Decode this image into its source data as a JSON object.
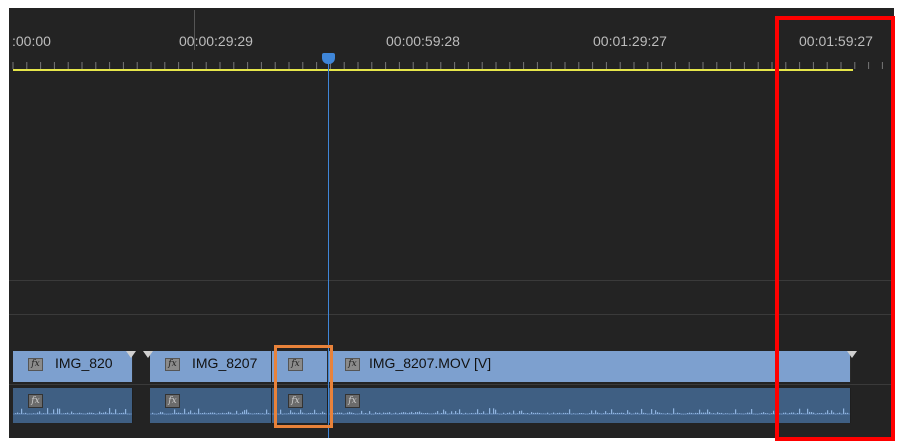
{
  "timeline": {
    "ruler_labels": [
      ":00:00",
      "00:00:29:29",
      "00:00:59:28",
      "00:01:29:27",
      "00:01:59:27"
    ],
    "video_clips": [
      {
        "label": "IMG_820",
        "fx": "fx"
      },
      {
        "label": "IMG_8207",
        "fx": "fx"
      },
      {
        "label": "",
        "fx": "fx"
      },
      {
        "label": "IMG_8207.MOV [V]",
        "fx": "fx"
      }
    ],
    "audio_clips": [
      {
        "fx": "fx"
      },
      {
        "fx": "fx"
      },
      {
        "fx": "fx"
      },
      {
        "fx": "fx"
      }
    ]
  },
  "colors": {
    "background": "#232323",
    "ruler_line": "#e6e64a",
    "playhead": "#3f86d8",
    "video_clip": "#7da0cf",
    "audio_clip": "#3f5f83",
    "highlight_red": "#ff0000",
    "highlight_orange": "#e8823a"
  }
}
